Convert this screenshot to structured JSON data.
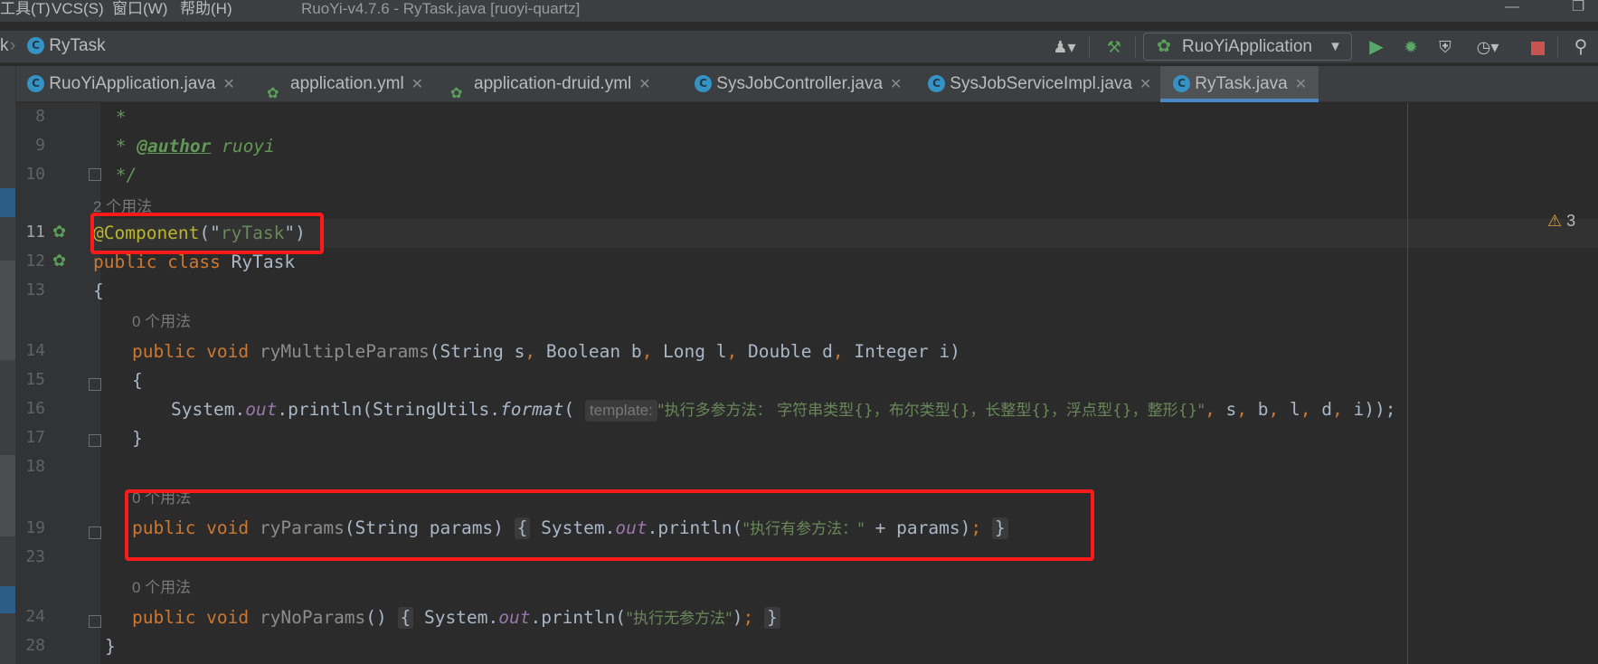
{
  "menu": {
    "items": [
      "工具(T)",
      "VCS(S)",
      "窗口(W)",
      "帮助(H)"
    ],
    "title": "RuoYi-v4.7.6 - RyTask.java [ruoyi-quartz]"
  },
  "nav": {
    "crumb_prev": "k",
    "crumb_current": "RyTask",
    "run_config": "RuoYiApplication",
    "class_icon_letter": "C"
  },
  "tabs": [
    {
      "label": "RuoYiApplication.java",
      "icon": "class-icon"
    },
    {
      "label": "application.yml",
      "icon": "yaml-icon"
    },
    {
      "label": "application-druid.yml",
      "icon": "yaml-icon"
    },
    {
      "label": "SysJobController.java",
      "icon": "class-icon"
    },
    {
      "label": "SysJobServiceImpl.java",
      "icon": "class-icon"
    },
    {
      "label": "RyTask.java",
      "icon": "class-icon",
      "active": true
    }
  ],
  "editor": {
    "warnings": "3",
    "line_numbers": [
      "8",
      "9",
      "10",
      "11",
      "12",
      "13",
      "14",
      "15",
      "16",
      "17",
      "18",
      "19",
      "23",
      "24",
      "28"
    ],
    "usages": {
      "class": "2 个用法",
      "m1": "0 个用法",
      "m2": "0 个用法",
      "m3": "0 个用法"
    },
    "code": {
      "l8": " *",
      "l9_star": " * ",
      "l9_tag": "@author",
      "l9_val": " ruoyi",
      "l10": " */",
      "l11_ann": "@Component",
      "l11_open": "(\"",
      "l11_name": "ryTask",
      "l11_close": "\")",
      "l12_kw": "public class",
      "l12_name": " RyTask",
      "l13": "{",
      "l14_kw": "public void",
      "l14_name": "ryMultipleParams",
      "l14_sig_a": "(String s",
      "l14_sig_b": " Boolean b",
      "l14_sig_c": " Long l",
      "l14_sig_d": " Double d",
      "l14_sig_e": " Integer i)",
      "comma": ",",
      "l15": "{",
      "l16_a": "System.",
      "l16_out": "out",
      "l16_b": ".println(StringUtils.",
      "l16_fmt": "format",
      "l16_c": "(",
      "l16_hint": "template:",
      "l16_str": "\"执行多参方法： 字符串类型{}，布尔类型{}，长整型{}，浮点型{}，整形{}\"",
      "l16_args_s": " s",
      "l16_args_b": " b",
      "l16_args_l": " l",
      "l16_args_d": " d",
      "l16_args_i": " i));",
      "l17": "}",
      "l19_kw": "public void",
      "l19_name": "ryParams",
      "l19_sig": "(String params)",
      "l19_body_a": "System.",
      "l19_out": "out",
      "l19_body_b": ".println(",
      "l19_str": "\"执行有参方法：\"",
      "l19_body_c": " + params)",
      "semi": ";",
      "brace_open": "{",
      "brace_close": "}",
      "l24_kw": "public void",
      "l24_name": "ryNoParams",
      "l24_sig": "()",
      "l24_body_a": "System.",
      "l24_out": "out",
      "l24_body_b": ".println(",
      "l24_str": "\"执行无参方法\"",
      "l24_body_c": ")",
      "l28": "}"
    }
  }
}
